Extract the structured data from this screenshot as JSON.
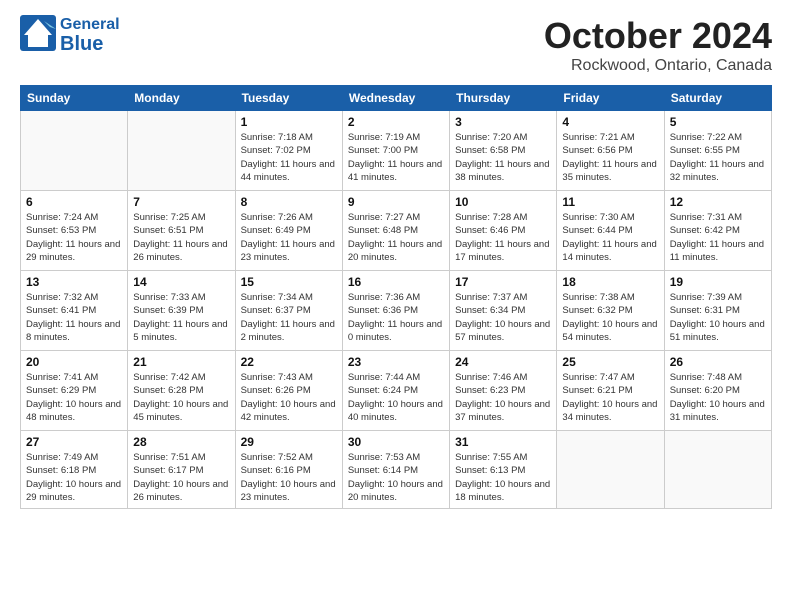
{
  "header": {
    "logo_general": "General",
    "logo_blue": "Blue",
    "title": "October 2024",
    "subtitle": "Rockwood, Ontario, Canada"
  },
  "weekdays": [
    "Sunday",
    "Monday",
    "Tuesday",
    "Wednesday",
    "Thursday",
    "Friday",
    "Saturday"
  ],
  "weeks": [
    [
      {
        "day": "",
        "detail": ""
      },
      {
        "day": "",
        "detail": ""
      },
      {
        "day": "1",
        "detail": "Sunrise: 7:18 AM\nSunset: 7:02 PM\nDaylight: 11 hours and 44 minutes."
      },
      {
        "day": "2",
        "detail": "Sunrise: 7:19 AM\nSunset: 7:00 PM\nDaylight: 11 hours and 41 minutes."
      },
      {
        "day": "3",
        "detail": "Sunrise: 7:20 AM\nSunset: 6:58 PM\nDaylight: 11 hours and 38 minutes."
      },
      {
        "day": "4",
        "detail": "Sunrise: 7:21 AM\nSunset: 6:56 PM\nDaylight: 11 hours and 35 minutes."
      },
      {
        "day": "5",
        "detail": "Sunrise: 7:22 AM\nSunset: 6:55 PM\nDaylight: 11 hours and 32 minutes."
      }
    ],
    [
      {
        "day": "6",
        "detail": "Sunrise: 7:24 AM\nSunset: 6:53 PM\nDaylight: 11 hours and 29 minutes."
      },
      {
        "day": "7",
        "detail": "Sunrise: 7:25 AM\nSunset: 6:51 PM\nDaylight: 11 hours and 26 minutes."
      },
      {
        "day": "8",
        "detail": "Sunrise: 7:26 AM\nSunset: 6:49 PM\nDaylight: 11 hours and 23 minutes."
      },
      {
        "day": "9",
        "detail": "Sunrise: 7:27 AM\nSunset: 6:48 PM\nDaylight: 11 hours and 20 minutes."
      },
      {
        "day": "10",
        "detail": "Sunrise: 7:28 AM\nSunset: 6:46 PM\nDaylight: 11 hours and 17 minutes."
      },
      {
        "day": "11",
        "detail": "Sunrise: 7:30 AM\nSunset: 6:44 PM\nDaylight: 11 hours and 14 minutes."
      },
      {
        "day": "12",
        "detail": "Sunrise: 7:31 AM\nSunset: 6:42 PM\nDaylight: 11 hours and 11 minutes."
      }
    ],
    [
      {
        "day": "13",
        "detail": "Sunrise: 7:32 AM\nSunset: 6:41 PM\nDaylight: 11 hours and 8 minutes."
      },
      {
        "day": "14",
        "detail": "Sunrise: 7:33 AM\nSunset: 6:39 PM\nDaylight: 11 hours and 5 minutes."
      },
      {
        "day": "15",
        "detail": "Sunrise: 7:34 AM\nSunset: 6:37 PM\nDaylight: 11 hours and 2 minutes."
      },
      {
        "day": "16",
        "detail": "Sunrise: 7:36 AM\nSunset: 6:36 PM\nDaylight: 11 hours and 0 minutes."
      },
      {
        "day": "17",
        "detail": "Sunrise: 7:37 AM\nSunset: 6:34 PM\nDaylight: 10 hours and 57 minutes."
      },
      {
        "day": "18",
        "detail": "Sunrise: 7:38 AM\nSunset: 6:32 PM\nDaylight: 10 hours and 54 minutes."
      },
      {
        "day": "19",
        "detail": "Sunrise: 7:39 AM\nSunset: 6:31 PM\nDaylight: 10 hours and 51 minutes."
      }
    ],
    [
      {
        "day": "20",
        "detail": "Sunrise: 7:41 AM\nSunset: 6:29 PM\nDaylight: 10 hours and 48 minutes."
      },
      {
        "day": "21",
        "detail": "Sunrise: 7:42 AM\nSunset: 6:28 PM\nDaylight: 10 hours and 45 minutes."
      },
      {
        "day": "22",
        "detail": "Sunrise: 7:43 AM\nSunset: 6:26 PM\nDaylight: 10 hours and 42 minutes."
      },
      {
        "day": "23",
        "detail": "Sunrise: 7:44 AM\nSunset: 6:24 PM\nDaylight: 10 hours and 40 minutes."
      },
      {
        "day": "24",
        "detail": "Sunrise: 7:46 AM\nSunset: 6:23 PM\nDaylight: 10 hours and 37 minutes."
      },
      {
        "day": "25",
        "detail": "Sunrise: 7:47 AM\nSunset: 6:21 PM\nDaylight: 10 hours and 34 minutes."
      },
      {
        "day": "26",
        "detail": "Sunrise: 7:48 AM\nSunset: 6:20 PM\nDaylight: 10 hours and 31 minutes."
      }
    ],
    [
      {
        "day": "27",
        "detail": "Sunrise: 7:49 AM\nSunset: 6:18 PM\nDaylight: 10 hours and 29 minutes."
      },
      {
        "day": "28",
        "detail": "Sunrise: 7:51 AM\nSunset: 6:17 PM\nDaylight: 10 hours and 26 minutes."
      },
      {
        "day": "29",
        "detail": "Sunrise: 7:52 AM\nSunset: 6:16 PM\nDaylight: 10 hours and 23 minutes."
      },
      {
        "day": "30",
        "detail": "Sunrise: 7:53 AM\nSunset: 6:14 PM\nDaylight: 10 hours and 20 minutes."
      },
      {
        "day": "31",
        "detail": "Sunrise: 7:55 AM\nSunset: 6:13 PM\nDaylight: 10 hours and 18 minutes."
      },
      {
        "day": "",
        "detail": ""
      },
      {
        "day": "",
        "detail": ""
      }
    ]
  ]
}
